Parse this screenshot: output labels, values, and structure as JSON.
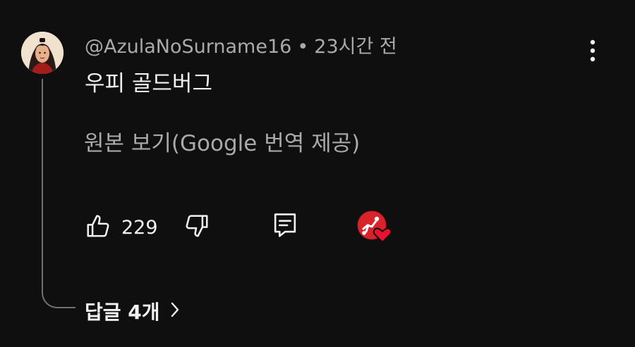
{
  "comment": {
    "author": "@AzulaNoSurname16",
    "separator": "•",
    "timestamp": "23시간 전",
    "text": "우피 골드버그",
    "translate_link": "원본 보기(Google 번역 제공)"
  },
  "actions": {
    "like_count": "229"
  },
  "replies": {
    "label": "답글 4개"
  },
  "icons": {
    "more": "more-vert-icon",
    "like": "thumbs-up-icon",
    "dislike": "thumbs-down-icon",
    "reply": "comment-icon",
    "creator_heart": "creator-heart-icon",
    "chevron": "chevron-right-icon"
  },
  "colors": {
    "background": "#0f0f0f",
    "text_primary": "#f1f1f1",
    "text_secondary": "#aaaaaa",
    "heart_red": "#e8122e"
  }
}
